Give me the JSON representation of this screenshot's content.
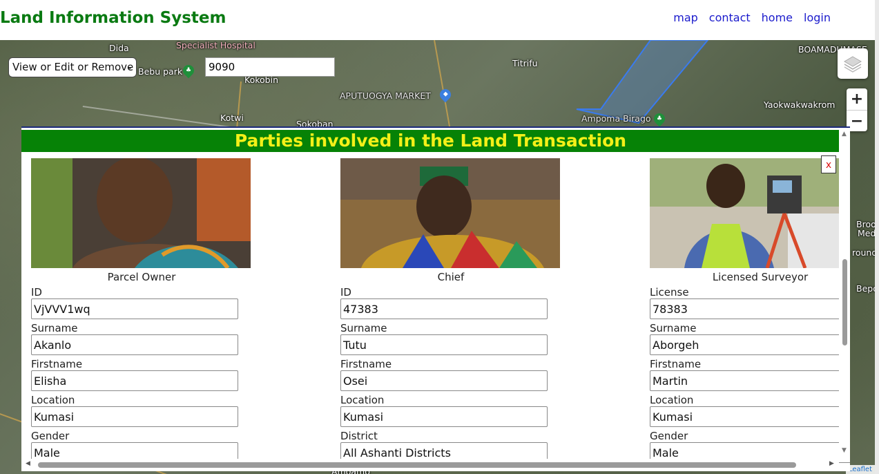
{
  "header": {
    "title": "Land Information System",
    "nav": [
      "map",
      "contact",
      "home",
      "login"
    ]
  },
  "map": {
    "mode_select": "View or Edit or Remove",
    "parcel_value": "9090",
    "labels": {
      "dida": "Dida",
      "hospital": "Specialist Hospital",
      "bebu": "Bebu park",
      "kokobin": "Kokobin",
      "titrifu": "Titrifu",
      "market": "APUTUOGYA MARKET",
      "kotwi": "Kotwi",
      "sokoban": "Sokoban",
      "boamadumase": "BOAMADUMASE",
      "yaokwakwakrom": "Yaokwakwakrom",
      "amponma": "Ampoma Birago",
      "broo": "Broo",
      "med": "Med",
      "round": "round",
      "bepo": "Bepo",
      "amoamo": "Amoamo"
    },
    "zoom_in": "+",
    "zoom_out": "−",
    "attribution": "Leaflet"
  },
  "modal": {
    "title": "Parties involved in the Land Transaction",
    "close_label": "x",
    "parties": [
      {
        "caption": "Parcel Owner",
        "fields": [
          {
            "label": "ID",
            "value": "VjVVV1wq"
          },
          {
            "label": "Surname",
            "value": "Akanlo"
          },
          {
            "label": "Firstname",
            "value": "Elisha"
          },
          {
            "label": "Location",
            "value": "Kumasi"
          },
          {
            "label": "Gender",
            "value": "Male"
          }
        ]
      },
      {
        "caption": "Chief",
        "fields": [
          {
            "label": "ID",
            "value": "47383"
          },
          {
            "label": "Surname",
            "value": "Tutu"
          },
          {
            "label": "Firstname",
            "value": "Osei"
          },
          {
            "label": "Location",
            "value": "Kumasi"
          },
          {
            "label": "District",
            "value": "All Ashanti Districts"
          }
        ]
      },
      {
        "caption": "Licensed Surveyor",
        "fields": [
          {
            "label": "License",
            "value": "78383"
          },
          {
            "label": "Surname",
            "value": "Aborgeh"
          },
          {
            "label": "Firstname",
            "value": "Martin"
          },
          {
            "label": "Location",
            "value": "Kumasi"
          },
          {
            "label": "Gender",
            "value": "Male"
          }
        ]
      }
    ]
  },
  "colors": {
    "brand": "#0a7a12",
    "modal_title_bg": "#068206",
    "modal_title_text": "#f4f018",
    "nav_link": "#1a1acc"
  }
}
